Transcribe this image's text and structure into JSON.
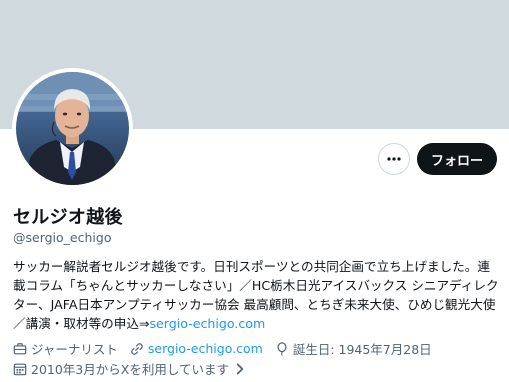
{
  "profile": {
    "display_name": "セルジオ越後",
    "handle": "@sergio_echigo",
    "bio_text": "サッカー解説者セルジオ越後です。日刊スポーツとの共同企画で立ち上げました。連載コラム「ちゃんとサッカーしなさい」／HC栃木日光アイスバックス シニアディレクター、JAFA日本アンプティサッカー協会 最高顧問、とちぎ未来大使、ひめじ観光大使／講演・取材等の申込⇒",
    "bio_link": "sergio-echigo.com"
  },
  "actions": {
    "follow_label": "フォロー",
    "more_icon": "more-dots-icon"
  },
  "meta": {
    "profession": "ジャーナリスト",
    "website": "sergio-echigo.com",
    "birthday": "誕生日: 1945年7月28日",
    "joined": "2010年3月からXを利用しています"
  },
  "colors": {
    "accent": "#1d9bf0",
    "banner": "#cfd9de",
    "text": "#0f1419",
    "secondary": "#536471"
  }
}
